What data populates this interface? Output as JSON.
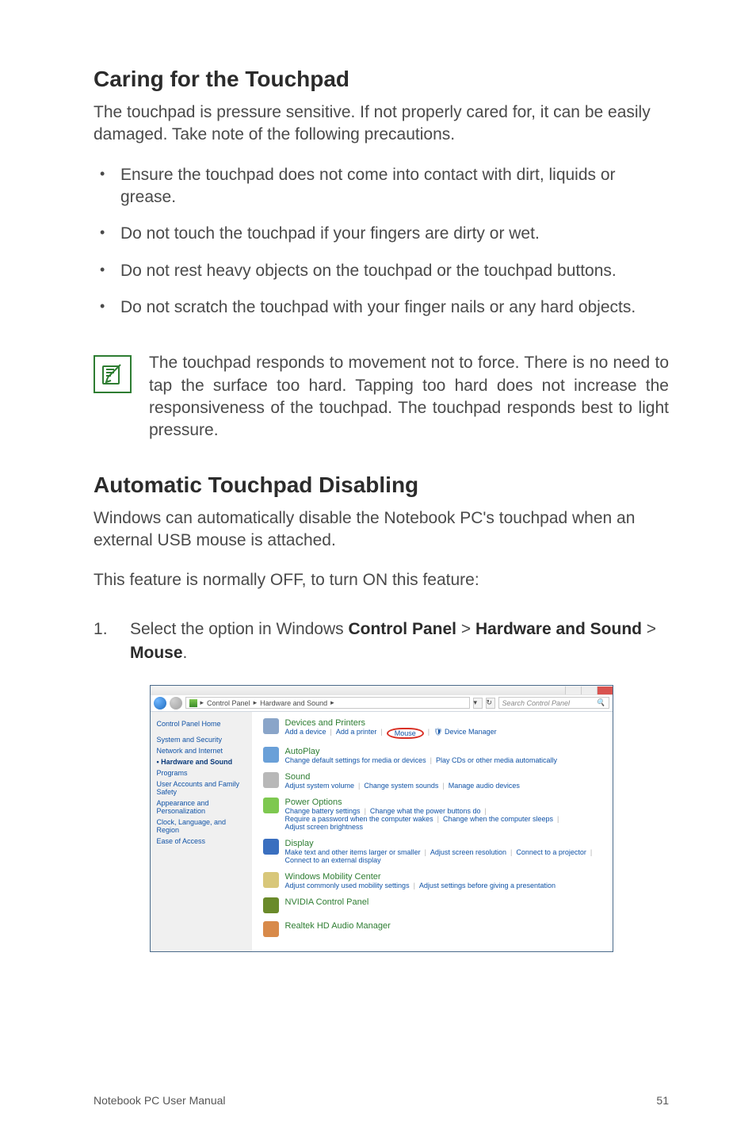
{
  "section1": {
    "title": "Caring for the Touchpad",
    "intro": "The touchpad is pressure sensitive. If not properly cared for, it can be easily damaged. Take note of the following precautions.",
    "bullets": [
      "Ensure the touchpad does not come into contact with dirt, liquids or grease.",
      "Do not touch the touchpad if your fingers are dirty or wet.",
      "Do not rest heavy objects on the touchpad or the touchpad buttons.",
      "Do not scratch the touchpad with your finger nails or any hard objects."
    ],
    "note": "The touchpad responds to movement not to force. There is no need to tap the surface too hard. Tapping too hard does not increase the responsiveness of the touchpad. The touchpad responds best to light pressure."
  },
  "section2": {
    "title": "Automatic Touchpad Disabling",
    "p1": "Windows can automatically disable the Notebook PC's touchpad when an external USB mouse is attached.",
    "p2": "This feature is normally OFF, to turn ON this feature:",
    "step1_pre": "Select the option in Windows ",
    "step1_b1": "Control Panel",
    "step1_gt1": " > ",
    "step1_b2": "Hardware and Sound",
    "step1_gt2": " > ",
    "step1_b3": "Mouse",
    "step1_post": "."
  },
  "cp": {
    "path_seg1": "Control Panel",
    "path_seg2": "Hardware and Sound",
    "search_placeholder": "Search Control Panel",
    "side": [
      "Control Panel Home",
      "System and Security",
      "Network and Internet",
      "Hardware and Sound",
      "Programs",
      "User Accounts and Family Safety",
      "Appearance and Personalization",
      "Clock, Language, and Region",
      "Ease of Access"
    ],
    "items": [
      {
        "title": "Devices and Printers",
        "links": [
          "Add a device",
          "Add a printer"
        ],
        "mouse": "Mouse",
        "trailing": "Device Manager",
        "iconColor": "#8aa5c9"
      },
      {
        "title": "AutoPlay",
        "links": [
          "Change default settings for media or devices",
          "Play CDs or other media automatically"
        ],
        "iconColor": "#6aa0d8"
      },
      {
        "title": "Sound",
        "links": [
          "Adjust system volume",
          "Change system sounds",
          "Manage audio devices"
        ],
        "iconColor": "#b8b8b8"
      },
      {
        "title": "Power Options",
        "links": [
          "Change battery settings",
          "Change what the power buttons do",
          "Require a password when the computer wakes",
          "Change when the computer sleeps",
          "Adjust screen brightness"
        ],
        "iconColor": "#7ec850"
      },
      {
        "title": "Display",
        "links": [
          "Make text and other items larger or smaller",
          "Adjust screen resolution",
          "Connect to a projector",
          "Connect to an external display"
        ],
        "iconColor": "#3a6fbf"
      },
      {
        "title": "Windows Mobility Center",
        "links": [
          "Adjust commonly used mobility settings",
          "Adjust settings before giving a presentation"
        ],
        "iconColor": "#d8c77a"
      },
      {
        "title": "NVIDIA Control Panel",
        "links": [],
        "iconColor": "#6a8a2a"
      },
      {
        "title": "Realtek HD Audio Manager",
        "links": [],
        "iconColor": "#d88a4a"
      }
    ]
  },
  "footer": {
    "left": "Notebook PC User Manual",
    "right": "51"
  }
}
